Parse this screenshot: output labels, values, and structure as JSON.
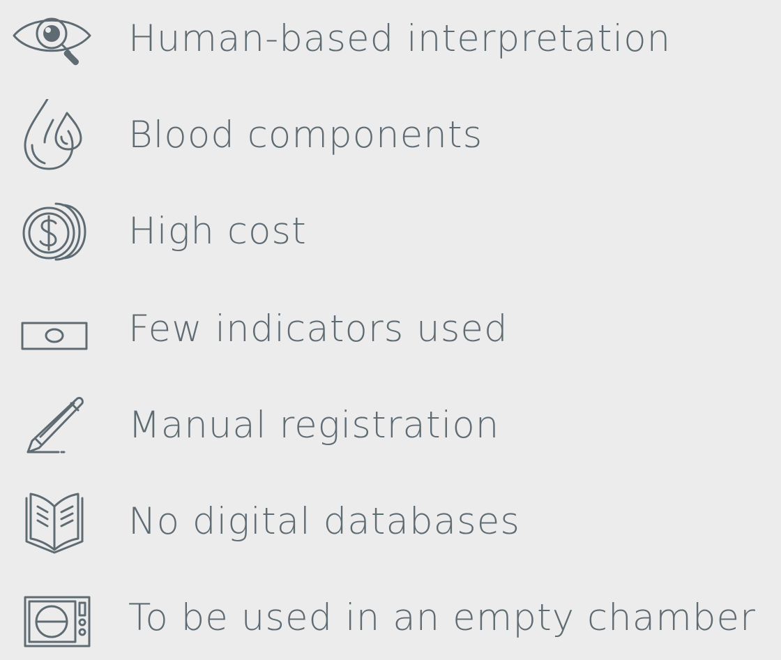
{
  "items": [
    {
      "label": "Human-based interpretation",
      "icon": "eye-magnifier-icon"
    },
    {
      "label": "Blood components",
      "icon": "blood-drops-icon"
    },
    {
      "label": "High cost",
      "icon": "coins-dollar-icon"
    },
    {
      "label": "Few indicators used",
      "icon": "banknote-icon"
    },
    {
      "label": "Manual registration",
      "icon": "pencil-icon"
    },
    {
      "label": "No digital databases",
      "icon": "open-book-icon"
    },
    {
      "label": "To be used in an empty chamber",
      "icon": "microwave-chamber-icon"
    }
  ],
  "colors": {
    "background": "#ececec",
    "foreground": "#5f6b72"
  }
}
